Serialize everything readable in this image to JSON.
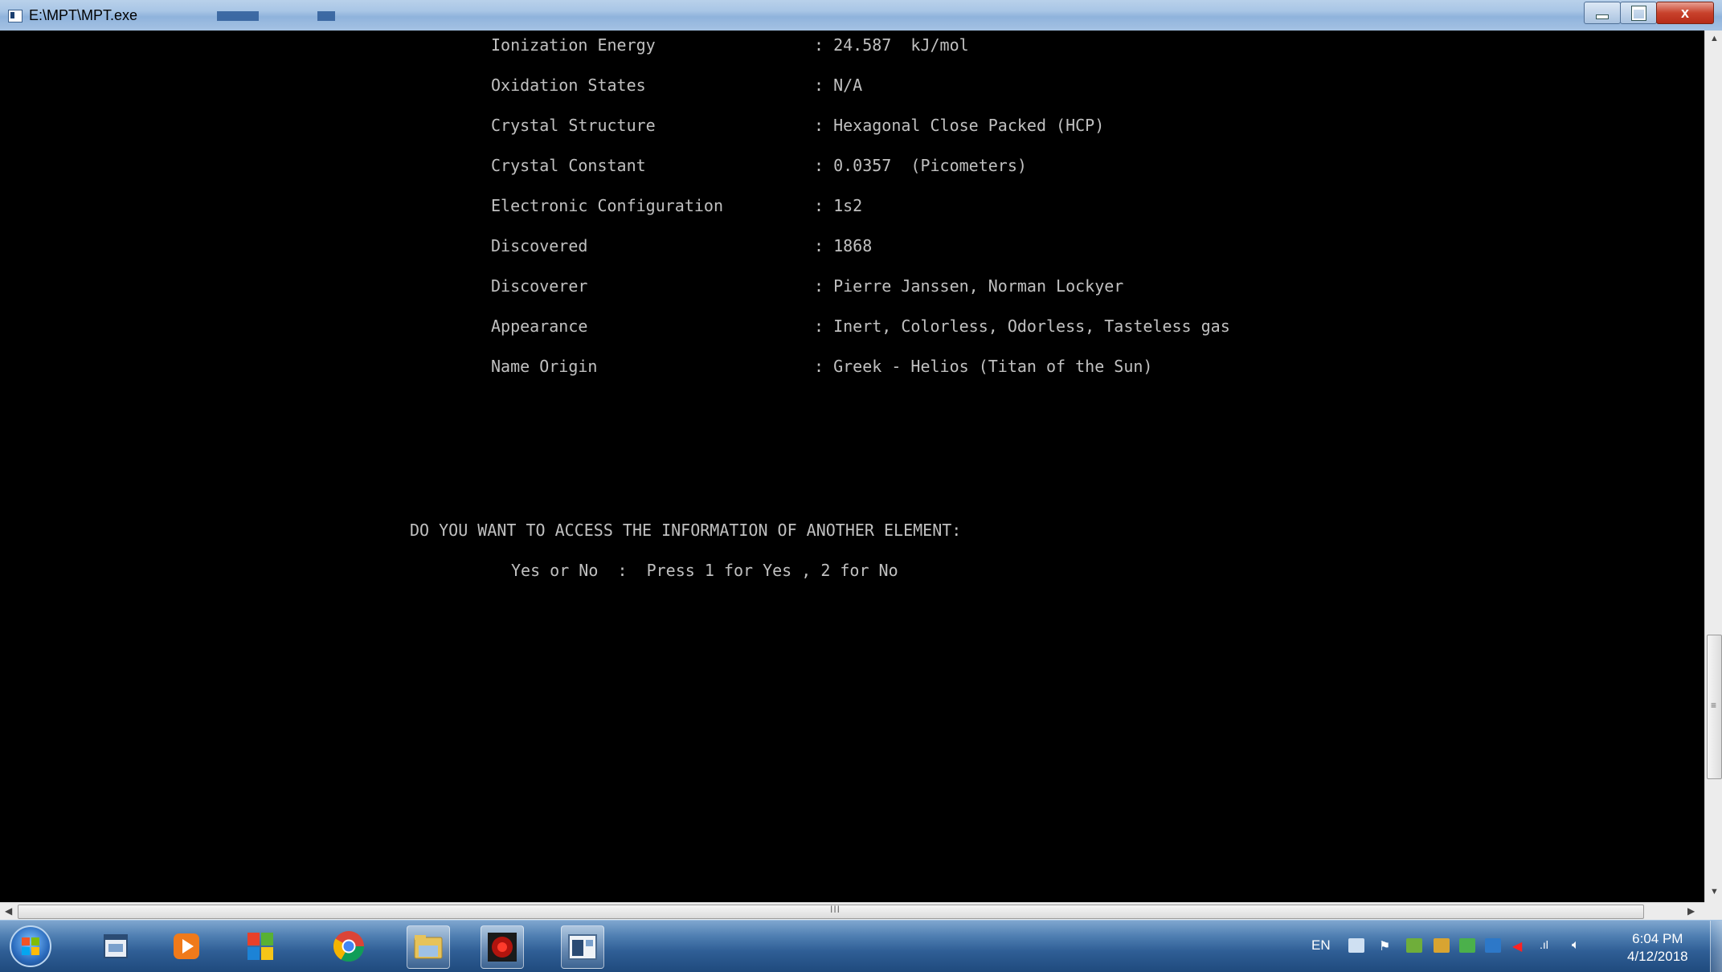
{
  "window": {
    "title": "E:\\MPT\\MPT.exe",
    "close_label": "x"
  },
  "console": {
    "rows": [
      {
        "label": "Ionization Energy",
        "value": ": 24.587  kJ/mol"
      },
      {
        "label": "Oxidation States",
        "value": ": N/A"
      },
      {
        "label": "Crystal Structure",
        "value": ": Hexagonal Close Packed (HCP)"
      },
      {
        "label": "Crystal Constant",
        "value": ": 0.0357  (Picometers)"
      },
      {
        "label": "Electronic Configuration",
        "value": ": 1s2"
      },
      {
        "label": "Discovered",
        "value": ": 1868"
      },
      {
        "label": "Discoverer",
        "value": ": Pierre Janssen, Norman Lockyer"
      },
      {
        "label": "Appearance",
        "value": ": Inert, Colorless, Odorless, Tasteless gas"
      },
      {
        "label": "Name Origin",
        "value": ": Greek - Helios (Titan of the Sun)"
      }
    ],
    "prompt_question": "DO YOU WANT TO ACCESS THE INFORMATION OF ANOTHER ELEMENT:",
    "prompt_options": "Yes or No  :  Press 1 for Yes , 2 for No"
  },
  "scrollbars": {
    "h_grip": "III",
    "v_grip": "≡"
  },
  "taskbar": {
    "apps": [
      "windows-explorer-icon",
      "media-player-icon",
      "windows-logo-icon",
      "chrome-icon",
      "file-explorer-icon",
      "app-red-icon",
      "console-app-icon"
    ],
    "language": "EN",
    "time": "6:04 PM",
    "date": "4/12/2018"
  },
  "colors": {
    "console_bg": "#000000",
    "console_text": "#c0c0c0",
    "taskbar": "#2f5e95",
    "close_button": "#c8422c"
  }
}
